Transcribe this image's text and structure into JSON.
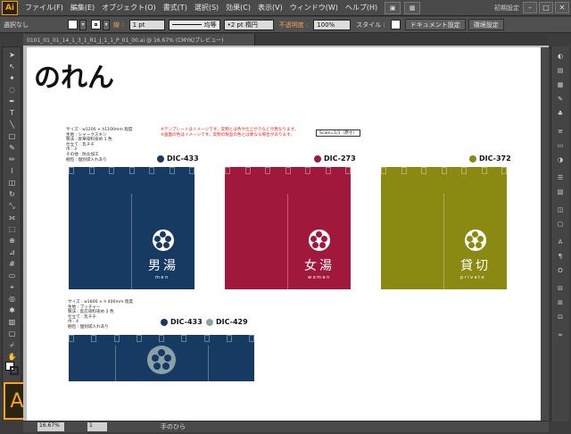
{
  "app": {
    "logo": "Ai",
    "workspace": "初期設定",
    "menu": [
      "ファイル(F)",
      "編集(E)",
      "オブジェクト(O)",
      "書式(T)",
      "選択(S)",
      "効果(C)",
      "表示(V)",
      "ウィンドウ(W)",
      "ヘルプ(H)"
    ]
  },
  "control_bar": {
    "selection": "選択なし",
    "stroke_label": "線 :",
    "stroke_weight": "1 pt",
    "stroke_style": "均等",
    "brush": "2 pt 楕円",
    "opacity_label": "不透明度 :",
    "opacity": "100%",
    "style_label": "スタイル :",
    "doc_settings": "ドキュメント設定",
    "prefs": "環境設定"
  },
  "document_tab": "0101_01_01_14_1_3_1_R1_J_1_1_P_01_00.ai @ 16.67% (CMYK/プレビュー)",
  "canvas": {
    "title": "のれん",
    "scale": "Scale=1/1（原寸）",
    "red_note": "※テンプレートはイメージです。実物とは色や仕上がりなどが異なります。\n※画面の色はイメージです。実物の製品の色とは異なる場合があります。",
    "spec1": "サイズ : w1200 × h1100mm 程度\n生地 : シャークスキン\n製法 : 昇華染料染め 1 色\n仕立て : 乳チチ\n巾 : 3\nその他 : 防炎加工\n梱包 : 個別袋入れあり",
    "spec2": "サイズ : w1800 × h 400mm 程度\n生地 : ブッチャー\n製法 : 反応染料染め 2 色\n仕立て : 乳チチ\n巾 : 4\n梱包 : 個別袋入れあり",
    "noren": [
      {
        "dic": "DIC-433",
        "color": "#173a63",
        "text": "男湯",
        "sub": "men"
      },
      {
        "dic": "DIC-273",
        "color": "#a0193c",
        "text": "女湯",
        "sub": "women"
      },
      {
        "dic": "DIC-372",
        "color": "#8a8a12",
        "text": "貸切",
        "sub": "private"
      }
    ],
    "banner": {
      "dic1": "DIC-433",
      "color1": "#173a63",
      "dic2": "DIC-429",
      "color2": "#8aa1a8"
    }
  },
  "status": {
    "zoom": "16.67%",
    "page": "1",
    "tool": "手のひら"
  }
}
